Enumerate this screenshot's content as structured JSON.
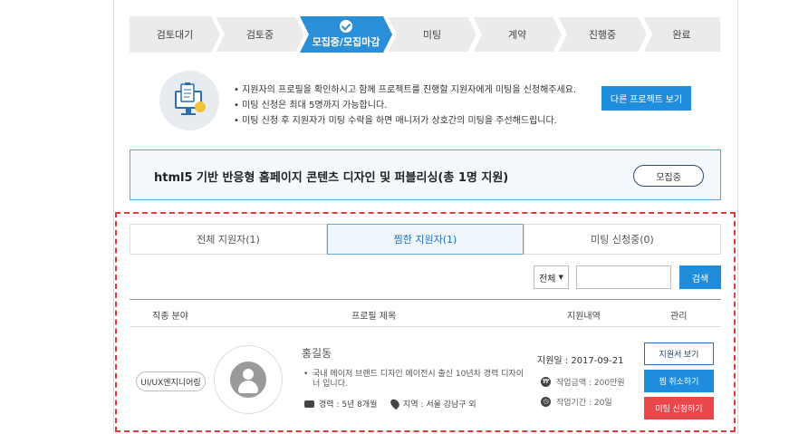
{
  "steps": [
    {
      "label": "검토대기",
      "active": false
    },
    {
      "label": "검토중",
      "active": false
    },
    {
      "label": "모집중/모집마감",
      "active": true
    },
    {
      "label": "미팅",
      "active": false
    },
    {
      "label": "계약",
      "active": false
    },
    {
      "label": "진행중",
      "active": false
    },
    {
      "label": "완료",
      "active": false
    }
  ],
  "info": {
    "lines": [
      "지원자의 프로필을 확인하시고 함께 프로젝트를 진행할 지원자에게 미팅을 신청해주세요.",
      "미팅 신청은 최대 5명까지 가능합니다.",
      "미팅 신청 후 지원자가 미팅 수락을 하면 매니저가 상호간의 미팅을 주선해드립니다."
    ],
    "button": "다른 프로젝트 보기"
  },
  "project": {
    "title": "html5 기반 반응형 홈페이지 콘텐츠 디자인 및 퍼블리싱(총 1명 지원)",
    "status": "모집중"
  },
  "tabs": [
    "전체 지원자(1)",
    "찜한 지원자(1)",
    "미팅 신청중(0)"
  ],
  "filter": {
    "select": "전체",
    "search_button": "검색",
    "input_value": ""
  },
  "table": {
    "headers": [
      "직종 분야",
      "프로필 제목",
      "지원내역",
      "관리"
    ]
  },
  "applicant": {
    "field": "UI/UX엔지니어링",
    "name": "홍길동",
    "description": "국내 메이저 브랜드 디자인 에이전시 출신 10년차 경력 디자이너 입니다.",
    "career": "경력 : 5년 8개월",
    "region": "지역 : 서울 강남구 외",
    "apply_date": "지원일 : 2017-09-21",
    "amount": "작업금액 : 200만원",
    "period": "작업기간 : 20일",
    "btn_view": "지원서 보기",
    "btn_unpick": "찜 취소하기",
    "btn_meet": "미팅 신청하기"
  },
  "colors": {
    "accent": "#1f8ddb",
    "danger": "#e8474b",
    "step_inactive": "#ebebeb"
  }
}
